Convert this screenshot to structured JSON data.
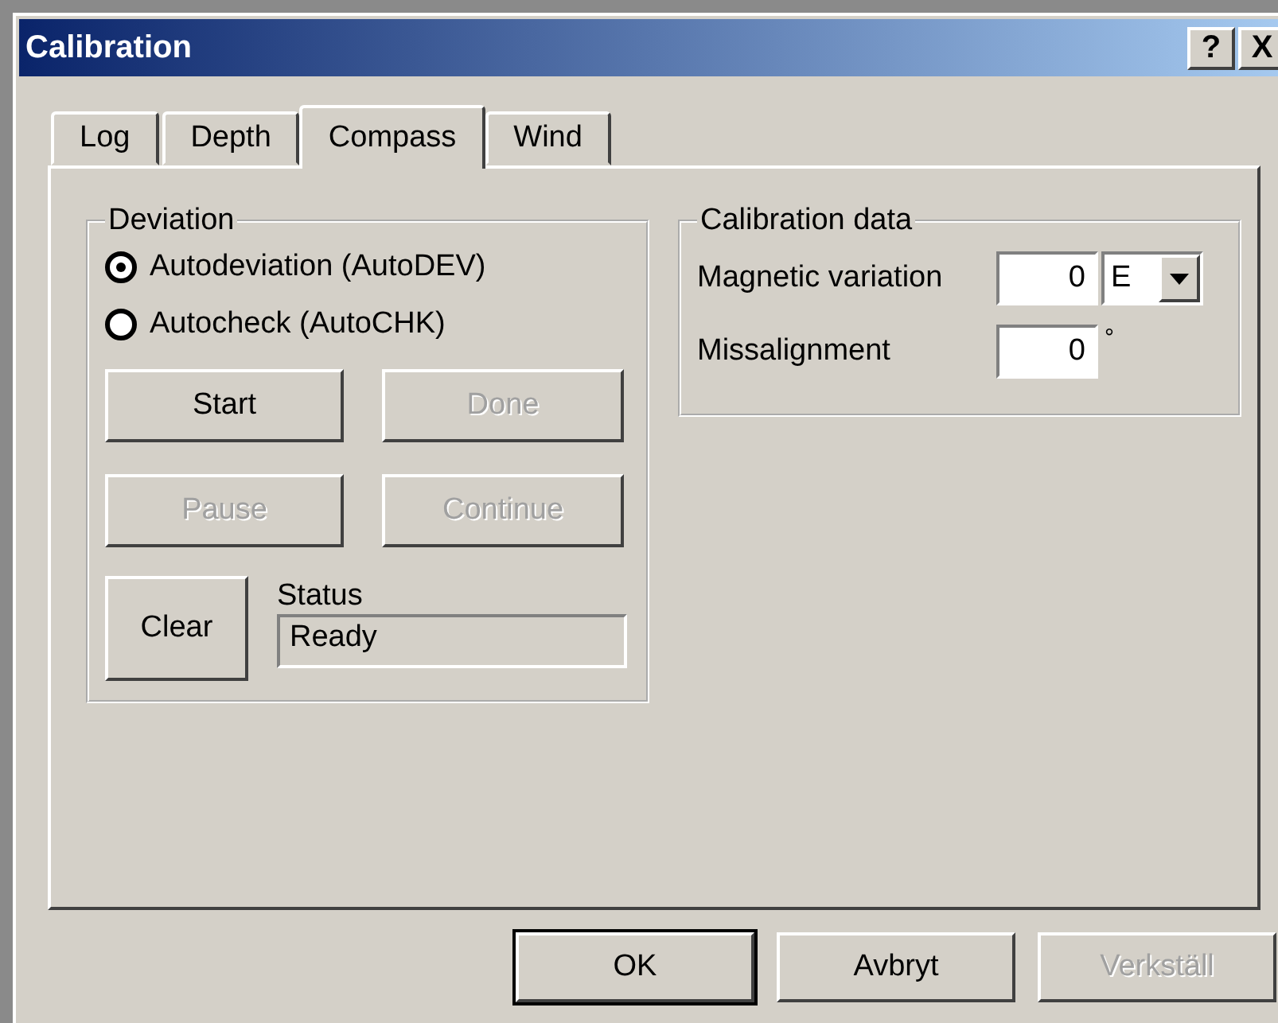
{
  "window": {
    "title": "Calibration",
    "title_buttons": [
      "?",
      "X"
    ]
  },
  "tabs": [
    {
      "label": "Log",
      "selected": false
    },
    {
      "label": "Depth",
      "selected": false
    },
    {
      "label": "Compass",
      "selected": true
    },
    {
      "label": "Wind",
      "selected": false
    }
  ],
  "deviation": {
    "title": "Deviation",
    "options": [
      {
        "label": "Autodeviation (AutoDEV)",
        "selected": true
      },
      {
        "label": "Autocheck (AutoCHK)",
        "selected": false
      }
    ],
    "buttons": [
      {
        "label": "Start",
        "disabled": false
      },
      {
        "label": "Done",
        "disabled": true
      },
      {
        "label": "Pause",
        "disabled": true
      },
      {
        "label": "Continue",
        "disabled": true
      }
    ],
    "clear_button": {
      "label": "Clear",
      "disabled": false
    },
    "status": {
      "label": "Status",
      "value": "Ready"
    }
  },
  "calibration_data": {
    "title": "Calibration data",
    "magnetic_variation": {
      "label": "Magnetic variation",
      "value": "0",
      "direction": "E"
    },
    "missalignment": {
      "label": "Missalignment",
      "value": "0",
      "unit": "°"
    }
  },
  "buttons": [
    {
      "label": "OK",
      "disabled": false,
      "default": true
    },
    {
      "label": "Avbryt",
      "disabled": false,
      "default": false
    },
    {
      "label": "Verkställ",
      "disabled": true,
      "default": false
    }
  ]
}
